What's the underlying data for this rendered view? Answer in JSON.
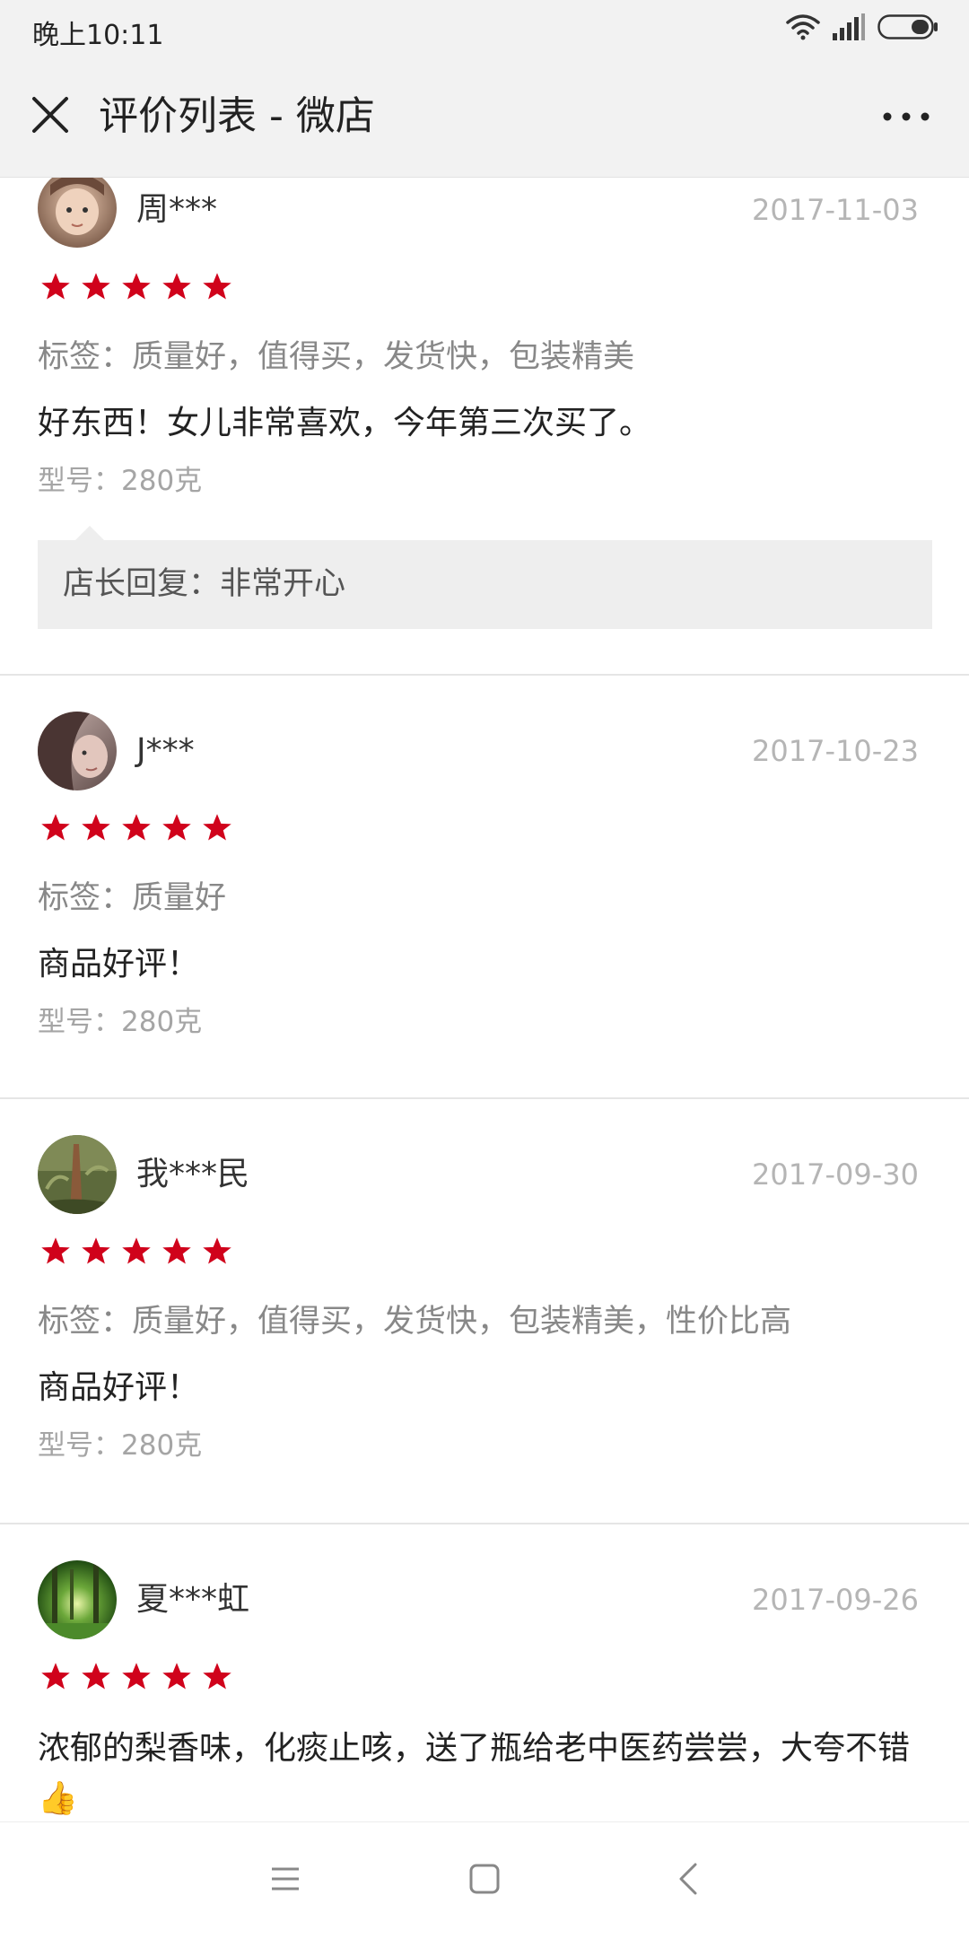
{
  "status_bar": {
    "time": "晚上10:11",
    "icons": [
      "wifi-icon",
      "signal-icon",
      "battery-icon"
    ]
  },
  "header": {
    "title": "评价列表 - 微店",
    "close_icon": "close-icon",
    "more_icon": "more-icon"
  },
  "colors": {
    "star": "#d0021b",
    "date": "#b5b5b5",
    "reply_bg": "#eeeeee"
  },
  "reviews": [
    {
      "user": "周***",
      "date": "2017-11-03",
      "rating": 5,
      "tags": "标签：质量好，值得买，发货快，包装精美",
      "comment": "好东西！女儿非常喜欢，今年第三次买了。",
      "model": "型号：280克",
      "reply": "店长回复：非常开心"
    },
    {
      "user": "J***",
      "date": "2017-10-23",
      "rating": 5,
      "tags": "标签：质量好",
      "comment": "商品好评！",
      "model": "型号：280克"
    },
    {
      "user": "我***民",
      "date": "2017-09-30",
      "rating": 5,
      "tags": "标签：质量好，值得买，发货快，包装精美，性价比高",
      "comment": "商品好评！",
      "model": "型号：280克"
    },
    {
      "user": "夏***虹",
      "date": "2017-09-26",
      "rating": 5,
      "comment": "浓郁的梨香味，化痰止咳，送了瓶给老中医药尝尝，大夸不错👍"
    }
  ],
  "bottom_nav": {
    "icons": [
      "menu-icon",
      "home-icon",
      "back-icon"
    ]
  }
}
